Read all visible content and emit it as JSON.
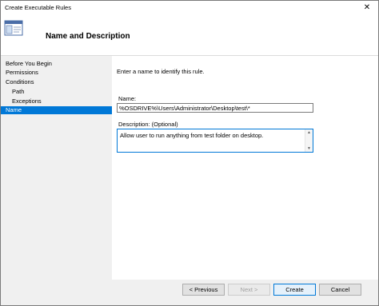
{
  "window": {
    "title": "Create Executable Rules",
    "close_glyph": "✕"
  },
  "header": {
    "heading": "Name and Description"
  },
  "sidebar": {
    "steps": [
      {
        "label": "Before You Begin"
      },
      {
        "label": "Permissions"
      },
      {
        "label": "Conditions"
      },
      {
        "label": "Path"
      },
      {
        "label": "Exceptions"
      },
      {
        "label": "Name"
      }
    ]
  },
  "main": {
    "instruction": "Enter a name to identify this rule.",
    "name_label": "Name:",
    "name_value": "%OSDRIVE%\\Users\\Administrator\\Desktop\\test\\*",
    "description_label": "Description: (Optional)",
    "description_value": "Allow user to run anything from test folder on desktop."
  },
  "footer": {
    "previous_label": "< Previous",
    "next_label": "Next >",
    "create_label": "Create",
    "cancel_label": "Cancel"
  },
  "colors": {
    "accent": "#0078d7",
    "sidebar_bg": "#f0f0f0"
  },
  "icons": {
    "wizard": "wizard-window-icon",
    "close": "close-icon"
  }
}
